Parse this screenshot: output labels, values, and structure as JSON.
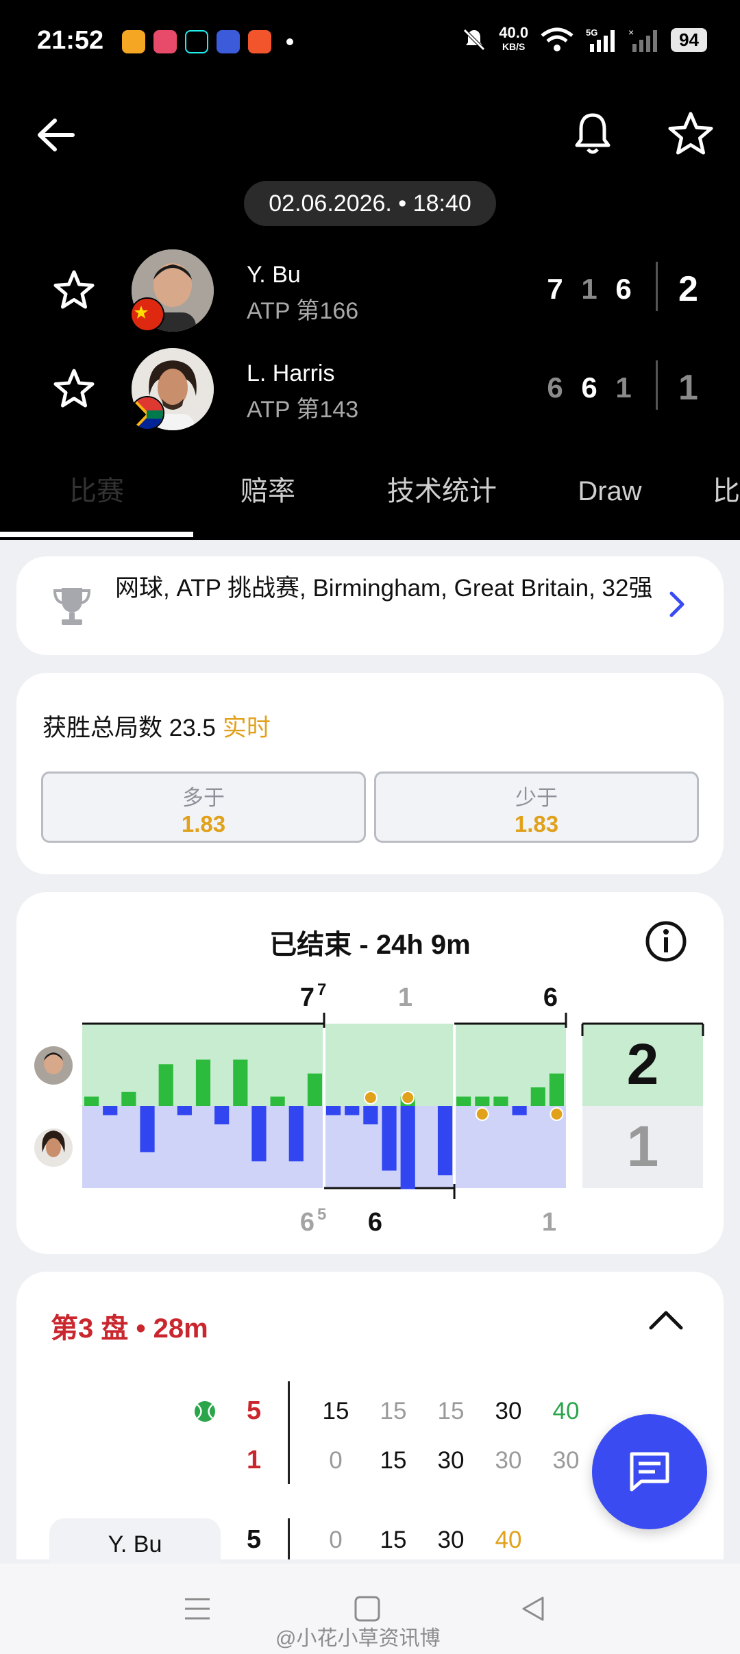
{
  "status_bar": {
    "time": "21:52",
    "net_speed_value": "40.0",
    "net_speed_unit": "KB/S",
    "battery": "94",
    "app_icons": [
      "weibo-icon",
      "app-icon",
      "tiktok-icon",
      "tieba-icon",
      "pinduoduo-icon"
    ]
  },
  "header": {
    "datetime": "02.06.2026. • 18:40",
    "players": [
      {
        "name": "Y. Bu",
        "rank": "ATP 第166",
        "sets": [
          "7",
          "1",
          "6"
        ],
        "sets_won": "2",
        "flag": "china-flag"
      },
      {
        "name": "L. Harris",
        "rank": "ATP 第143",
        "sets": [
          "6",
          "6",
          "1"
        ],
        "sets_won": "1",
        "flag": "south-africa-flag"
      }
    ],
    "tabs": [
      "比赛",
      "赔率",
      "技术统计",
      "Draw",
      "比"
    ]
  },
  "tournament": {
    "label": "网球, ATP 挑战赛, Birmingham, Great Britain, 32强"
  },
  "odds": {
    "title": "获胜总局数 23.5",
    "live": "实时",
    "over_label": "多于",
    "over_value": "1.83",
    "under_label": "少于",
    "under_value": "1.83"
  },
  "momentum": {
    "title": "已结束 - 24h 9m",
    "top_set_labels": [
      "7",
      "1",
      "6"
    ],
    "top_tiebreak": "7",
    "bottom_set_labels": [
      "6",
      "6",
      "1"
    ],
    "bottom_tiebreak": "5",
    "total_top": "2",
    "total_bottom": "1",
    "colors": {
      "player1": "#2cbb3c",
      "player2": "#3146f0",
      "p1_bg": "#c8ecd0",
      "p2_bg": "#ced3f7",
      "break": "#e1a11b"
    }
  },
  "chart_data": {
    "type": "bar",
    "title": "已结束 - 24h 9m",
    "series": [
      {
        "name": "Y. Bu",
        "values": [
          1,
          0,
          1.5,
          0,
          4.5,
          0,
          5,
          0,
          5,
          0,
          1,
          0,
          3.5,
          0,
          0,
          0,
          0,
          1,
          0,
          0,
          1,
          1,
          1,
          0,
          2,
          3.5
        ]
      },
      {
        "name": "L. Harris",
        "values": [
          0,
          1,
          0,
          5,
          0,
          1,
          0,
          2,
          0,
          6,
          0,
          6,
          0,
          1,
          1,
          2,
          7,
          9,
          0,
          7.5,
          0,
          0,
          0,
          1,
          0,
          0
        ]
      }
    ],
    "sets": [
      {
        "top": "7",
        "top_tiebreak": "7",
        "bottom": "6",
        "bottom_tiebreak": "5"
      },
      {
        "top": "1",
        "bottom": "6"
      },
      {
        "top": "6",
        "bottom": "1"
      }
    ],
    "legend": "left"
  },
  "set3": {
    "title": "第3 盘 • 28m",
    "rows": [
      {
        "games": "5",
        "points": [
          "15",
          "15",
          "15",
          "30",
          "40"
        ]
      },
      {
        "games": "1",
        "points": [
          "0",
          "15",
          "30",
          "30",
          "30"
        ]
      }
    ],
    "player_chip": "Y. Bu",
    "player_games": "5",
    "player_points": [
      "0",
      "15",
      "30",
      "40"
    ]
  },
  "watermark": "@小花小草资讯博"
}
